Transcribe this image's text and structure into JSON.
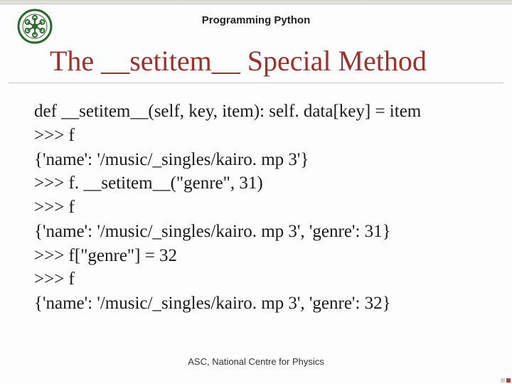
{
  "header": {
    "course_title": "Programming Python",
    "logo_alt": "institution-seal"
  },
  "title": "The __setitem__ Special Method",
  "code_lines": [
    "def __setitem__(self, key, item): self. data[key] = item",
    ">>> f",
    "{'name': '/music/_singles/kairo. mp 3'}",
    ">>> f. __setitem__(\"genre\", 31)",
    ">>> f",
    "{'name': '/music/_singles/kairo. mp 3', 'genre': 31}",
    ">>> f[\"genre\"] = 32",
    ">>> f",
    "{'name': '/music/_singles/kairo. mp 3', 'genre': 32}"
  ],
  "footer": "ASC, National Centre for Physics"
}
